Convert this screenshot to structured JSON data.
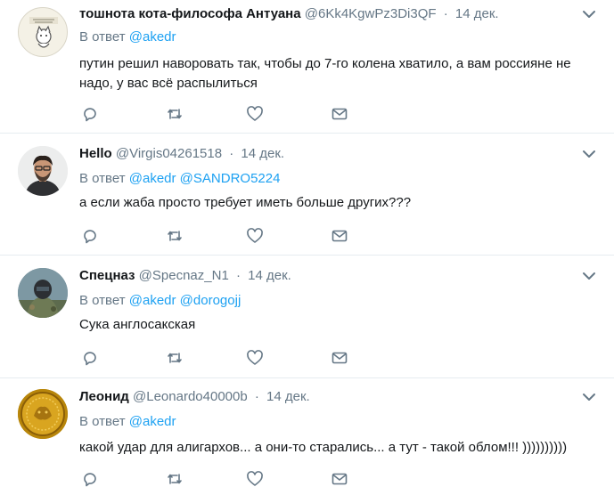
{
  "reply_prefix": "В ответ",
  "separator": "·",
  "tweets": [
    {
      "name": "тошнота кота-философа Антуана",
      "handle": "@6Kk4KgwPz3Di3QF",
      "date": "14 дек.",
      "mentions": [
        "@akedr"
      ],
      "text": "путин решил наворовать так, чтобы до 7-го колена хватило, а вам россияне не надо, у вас всё распылиться"
    },
    {
      "name": "Hello",
      "handle": "@Virgis04261518",
      "date": "14 дек.",
      "mentions": [
        "@akedr",
        "@SANDRO5224"
      ],
      "text": "а если жаба просто требует иметь больше других???"
    },
    {
      "name": "Спецназ",
      "handle": "@Specnaz_N1",
      "date": "14 дек.",
      "mentions": [
        "@akedr",
        "@dorogojj"
      ],
      "text": "Сука англосакская"
    },
    {
      "name": "Леонид",
      "handle": "@Leonardo40000b",
      "date": "14 дек.",
      "mentions": [
        "@akedr"
      ],
      "text": "какой удар для алигархов... а они-то старались... а тут - такой облом!!! ))))))))))"
    }
  ],
  "colors": {
    "accent": "#1da1f2",
    "muted": "#657786",
    "text": "#14171a",
    "divider": "#e6ecf0"
  },
  "icons": [
    "reply-icon",
    "retweet-icon",
    "like-icon",
    "dm-icon",
    "chevron-down-icon"
  ]
}
